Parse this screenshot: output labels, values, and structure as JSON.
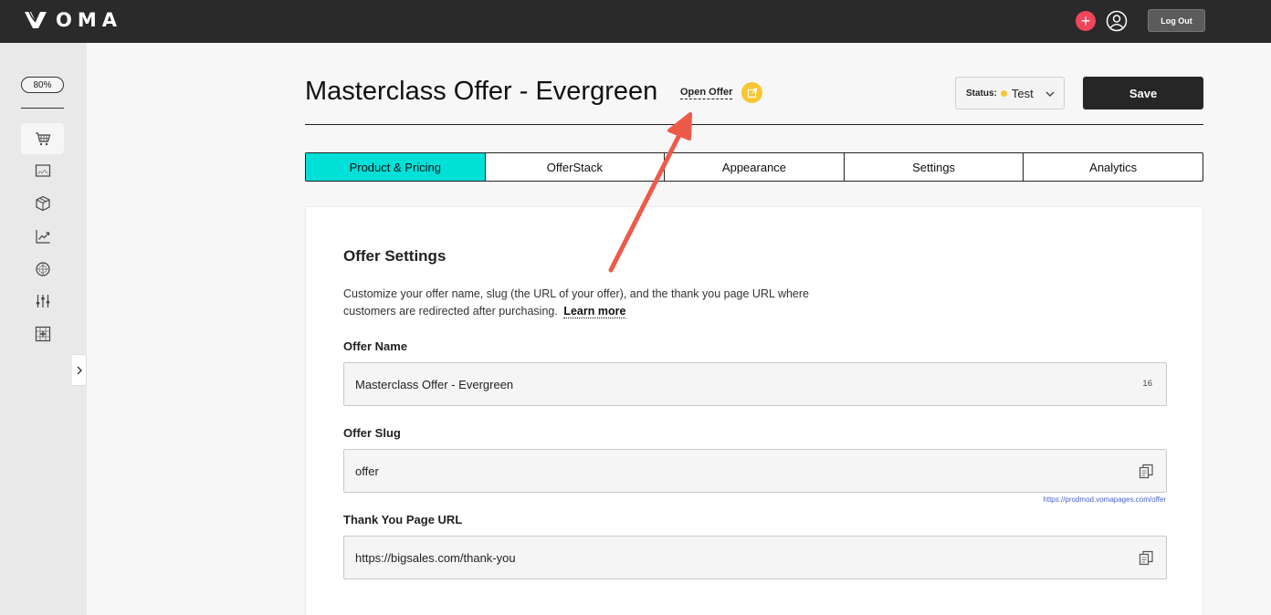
{
  "topbar": {
    "logo_text": "OMA",
    "plus_icon": "plus-icon",
    "user_icon": "user-circle-icon",
    "logout_label": "Log Out"
  },
  "sidebar": {
    "zoom": "80%",
    "icons": [
      "shopping-cart-icon",
      "image-frame-icon",
      "box-icon",
      "chart-line-icon",
      "globe-icon",
      "sliders-icon",
      "add-grid-icon"
    ],
    "expand_icon": "chevron-right-icon"
  },
  "header": {
    "title": "Masterclass Offer - Evergreen",
    "open_offer_label": "Open Offer",
    "open_offer_icon": "external-link-icon",
    "status_label": "Status:",
    "status_value": "Test",
    "status_color": "#f7c632",
    "save_label": "Save"
  },
  "tabs": [
    {
      "label": "Product & Pricing",
      "active": true
    },
    {
      "label": "OfferStack",
      "active": false
    },
    {
      "label": "Appearance",
      "active": false
    },
    {
      "label": "Settings",
      "active": false
    },
    {
      "label": "Analytics",
      "active": false
    }
  ],
  "accent_color": "#00e0d8",
  "offer_settings": {
    "title": "Offer Settings",
    "description": "Customize your offer name, slug (the URL of your offer), and the thank you page URL where customers are redirected after purchasing.",
    "learn_more": "Learn more",
    "offer_name_label": "Offer Name",
    "offer_name_value": "Masterclass Offer - Evergreen",
    "offer_name_count": "16",
    "offer_slug_label": "Offer Slug",
    "offer_slug_value": "offer",
    "offer_slug_url": "https://prodmod.vomapages.com/offer",
    "thank_you_label": "Thank You Page URL",
    "thank_you_value": "https://bigsales.com/thank-you"
  },
  "annotation_color": "#ee5a4a"
}
